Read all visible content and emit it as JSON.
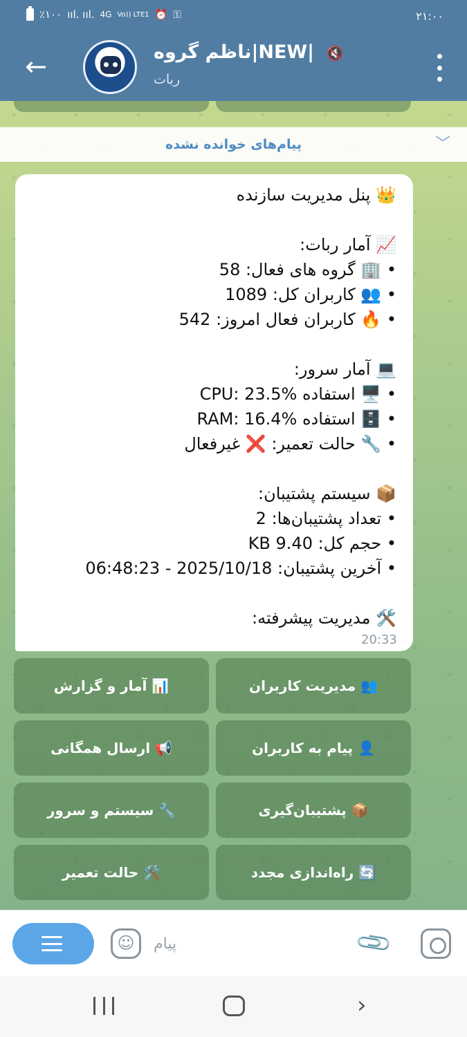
{
  "status_bar": {
    "time": "۲۱:۰۰",
    "battery": "٪۱۰۰",
    "signal": "ııl. ııl.",
    "network": "4G",
    "lte": "Vo)) LTE1",
    "icons": [
      "battery-icon",
      "signal-icon",
      "alarm-icon",
      "key-icon"
    ]
  },
  "header": {
    "title": "ناظم گروه|NEW|",
    "subtitle": "ربات",
    "mute_icon": "🔇"
  },
  "chat": {
    "unread_label": "پیام‌های خوانده نشده",
    "message": {
      "lines": [
        "👑 پنل مدیریت سازنده",
        "",
        "📈 آمار ربات:",
        "• 🏢 گروه های فعال: 58",
        "• 👥 کاربران کل: 1089",
        "• 🔥 کاربران فعال امروز: 542",
        "",
        "💻 آمار سرور:",
        "• 🖥️ استفاده CPU: 23.5%",
        "• 🗄️ استفاده RAM: 16.4%",
        "• 🔧 حالت تعمیر: ❌ غیرفعال",
        "",
        "📦 سیستم پشتیبان:",
        "• تعداد پشتیبان‌ها: 2",
        "• حجم کل: 9.40 KB",
        "• آخرین پشتیبان: 2025/10/18 - 06:48:23",
        "",
        "🛠️ مدیریت پیشرفته:"
      ],
      "time": "20:33"
    },
    "keyboard": [
      [
        "👥 مدیریت کاربران",
        "📊 آمار و گزارش"
      ],
      [
        "👤 پیام به کاربران",
        "📢 ارسال همگانی"
      ],
      [
        "📦 پشتیبان‌گیری",
        "🔧 سیستم و سرور"
      ],
      [
        "🔄 راه‌اندازی مجدد",
        "🛠️ حالت تعمیر"
      ]
    ]
  },
  "input": {
    "placeholder": "پیام"
  }
}
